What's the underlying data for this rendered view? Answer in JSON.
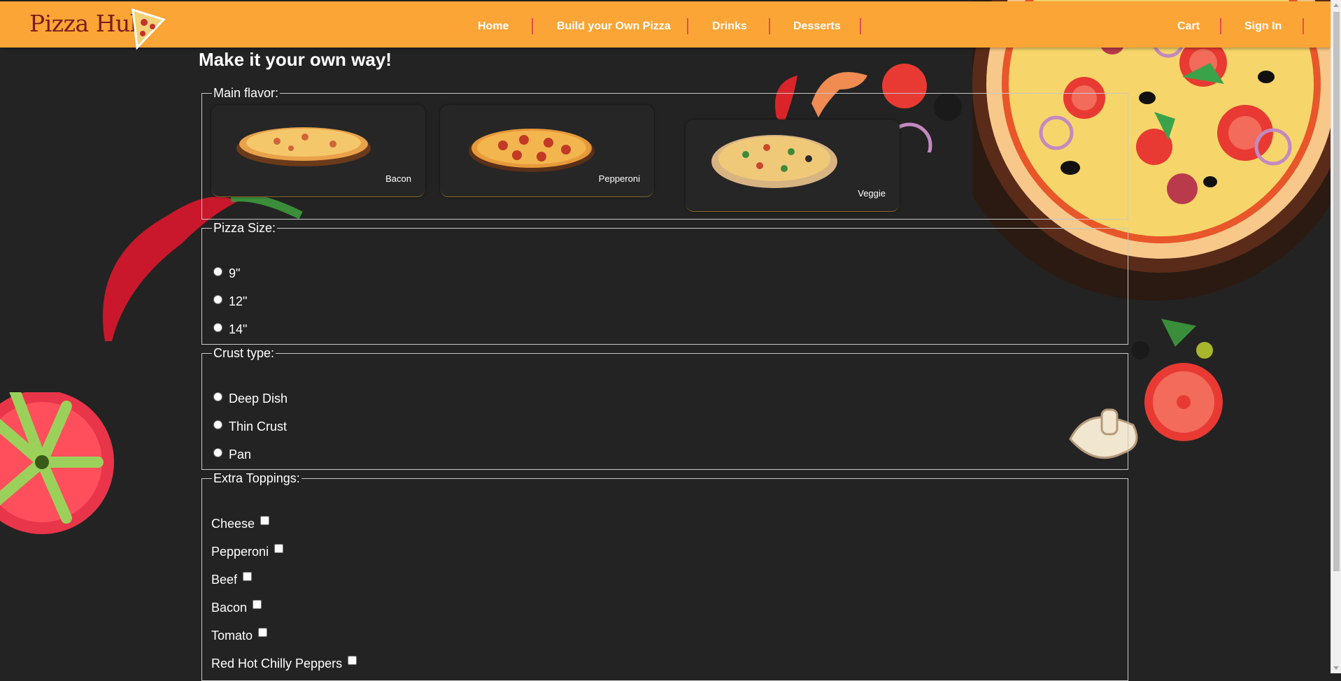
{
  "header": {
    "logo_text": "Pizza Hub",
    "nav": {
      "home": "Home",
      "build": "Build your Own Pizza",
      "drinks": "Drinks",
      "desserts": "Desserts",
      "cart": "Cart",
      "sign_in": "Sign In"
    },
    "bar_color": "#fba536",
    "separator_color": "#e05050"
  },
  "page": {
    "heading": "Make it your own way!",
    "background_color": "#232323"
  },
  "main_flavor": {
    "legend": "Main flavor:",
    "options": [
      {
        "label": "Bacon",
        "icon": "bacon-pizza-image"
      },
      {
        "label": "Pepperoni",
        "icon": "pepperoni-pizza-image"
      },
      {
        "label": "Veggie",
        "icon": "veggie-pizza-image"
      }
    ]
  },
  "pizza_size": {
    "legend": "Pizza Size:",
    "options": [
      "9\"",
      "12\"",
      "14\""
    ]
  },
  "crust_type": {
    "legend": "Crust type:",
    "options": [
      "Deep Dish",
      "Thin Crust",
      "Pan"
    ]
  },
  "extra_toppings": {
    "legend": "Extra Toppings:",
    "options": [
      "Cheese",
      "Pepperoni",
      "Beef",
      "Bacon",
      "Tomato",
      "Red Hot Chilly Peppers"
    ]
  }
}
